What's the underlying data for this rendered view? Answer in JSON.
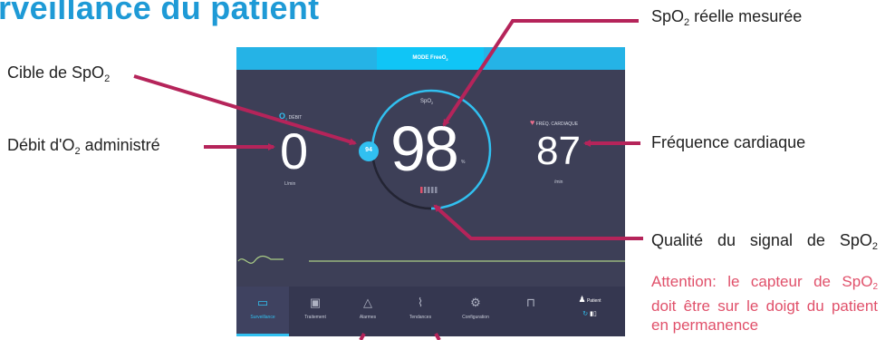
{
  "page": {
    "title": "rveillance du patient"
  },
  "annotations": {
    "spo2_target": "Cible de SpO",
    "spo2_target_sub": "2",
    "o2_flow": "Débit d'O",
    "o2_flow_sub": "2",
    "o2_flow_suffix": " administré",
    "spo2_measured": "SpO",
    "spo2_measured_sub": "2",
    "spo2_measured_suffix": " réelle mesurée",
    "heart_rate": "Fréquence cardiaque",
    "signal_quality": "Qualité du signal de SpO",
    "signal_quality_sub": "2",
    "warning_1": "Attention: le capteur de SpO",
    "warning_sub": "2",
    "warning_2": " doit être sur le doigt du patient en permanence"
  },
  "device": {
    "mode": "MODE FreeO",
    "mode_sub": "2",
    "o2_label": "DÉBIT",
    "o2_value": "0",
    "o2_unit": "L/min",
    "spo2_label": "SpO",
    "spo2_label_sub": "2",
    "spo2_value": "98",
    "spo2_unit": "%",
    "spo2_target": "94",
    "hr_label": "FRÉQ. CARDIAQUE",
    "hr_value": "87",
    "hr_unit": "/min",
    "signal_bars": 5,
    "signal_active_bars": 1
  },
  "nav": {
    "items": [
      {
        "label": "Surveillance",
        "icon": "monitor-icon"
      },
      {
        "label": "Traitement",
        "icon": "clipboard-icon"
      },
      {
        "label": "Alarmes",
        "icon": "bell-icon"
      },
      {
        "label": "Tendances",
        "icon": "trend-chart-icon"
      },
      {
        "label": "Configuration",
        "icon": "gear-icon"
      },
      {
        "label": "",
        "icon": "lock-icon"
      }
    ],
    "patient_label": "Patient"
  },
  "colors": {
    "accent": "#31c0f0",
    "arrow": "#b5245a",
    "background": "#3d3f57",
    "title": "#1e9ad6",
    "warning": "#e0506a"
  }
}
